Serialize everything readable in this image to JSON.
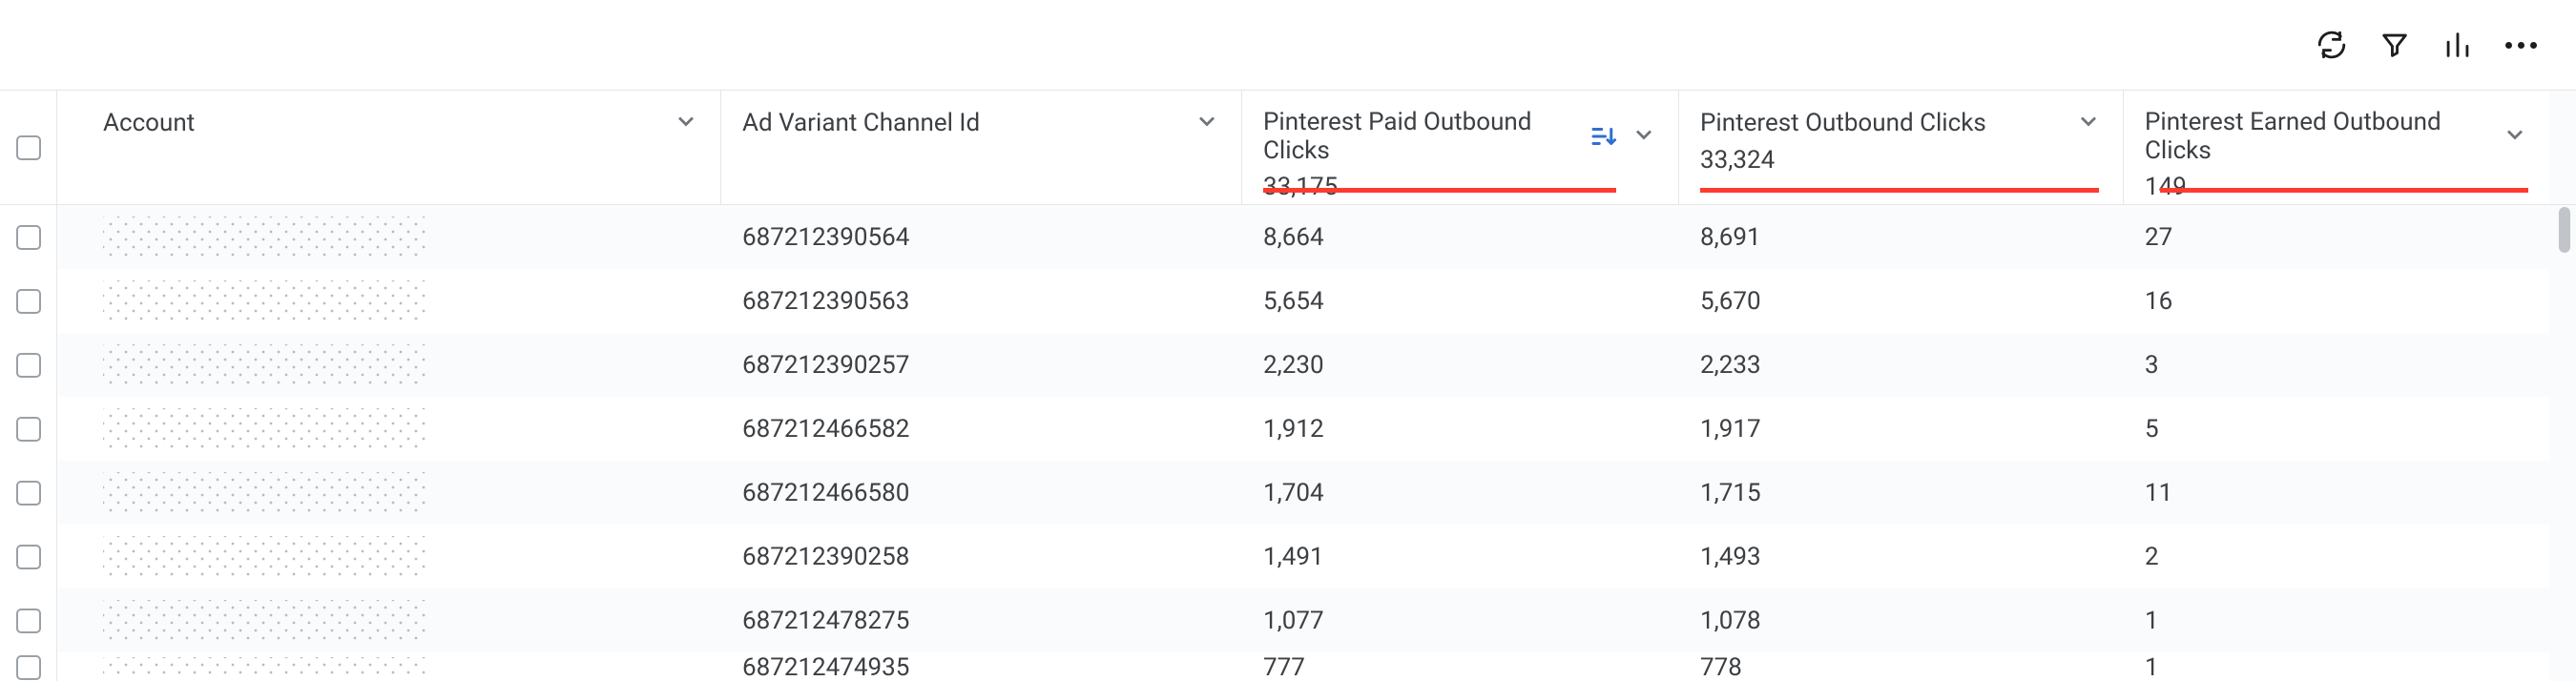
{
  "toolbar": {
    "icons": [
      "refresh",
      "filter",
      "bar-chart",
      "more"
    ]
  },
  "columns": {
    "account": {
      "label": "Account"
    },
    "ad_variant": {
      "label": "Ad Variant Channel Id"
    },
    "paid_outbound": {
      "label": "Pinterest Paid Outbound Clicks",
      "total": "33,175",
      "sorted": true
    },
    "outbound": {
      "label": "Pinterest Outbound Clicks",
      "total": "33,324"
    },
    "earned_outbound": {
      "label": "Pinterest Earned Outbound Clicks",
      "total": "149"
    }
  },
  "rows": [
    {
      "account": "",
      "ad_variant": "687212390564",
      "paid": "8,664",
      "out": "8,691",
      "earned": "27"
    },
    {
      "account": "",
      "ad_variant": "687212390563",
      "paid": "5,654",
      "out": "5,670",
      "earned": "16"
    },
    {
      "account": "",
      "ad_variant": "687212390257",
      "paid": "2,230",
      "out": "2,233",
      "earned": "3"
    },
    {
      "account": "",
      "ad_variant": "687212466582",
      "paid": "1,912",
      "out": "1,917",
      "earned": "5"
    },
    {
      "account": "",
      "ad_variant": "687212466580",
      "paid": "1,704",
      "out": "1,715",
      "earned": "11"
    },
    {
      "account": "",
      "ad_variant": "687212390258",
      "paid": "1,491",
      "out": "1,493",
      "earned": "2"
    },
    {
      "account": "",
      "ad_variant": "687212478275",
      "paid": "1,077",
      "out": "1,078",
      "earned": "1"
    },
    {
      "account": "",
      "ad_variant": "687212474935",
      "paid": "777",
      "out": "778",
      "earned": "1"
    }
  ]
}
